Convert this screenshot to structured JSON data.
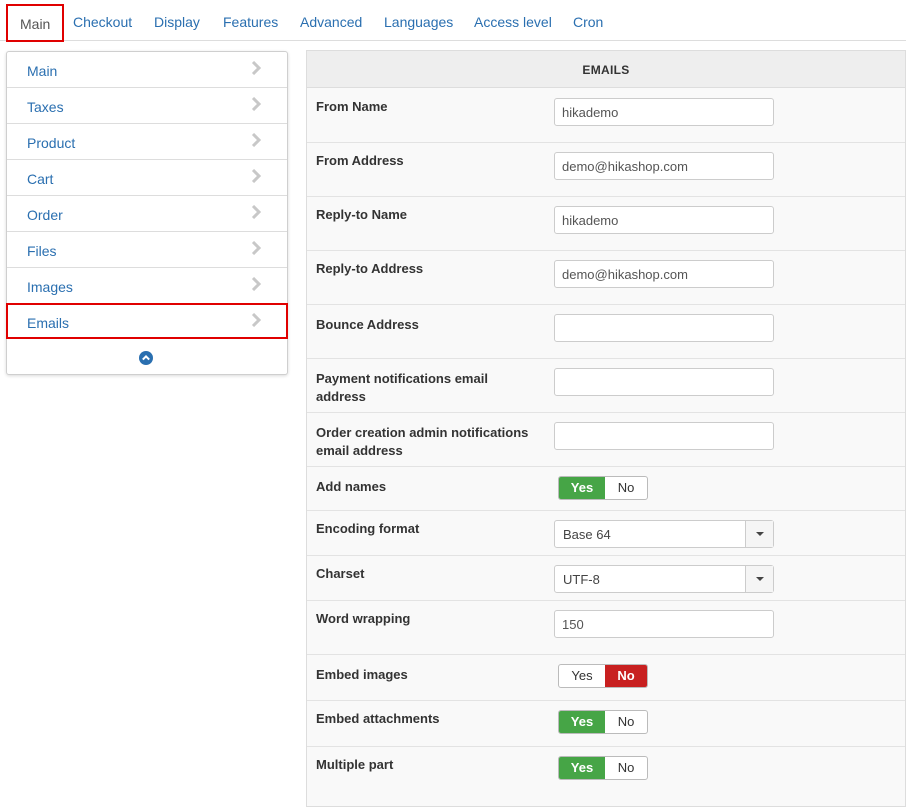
{
  "tabs": [
    {
      "label": "Main",
      "active": true
    },
    {
      "label": "Checkout"
    },
    {
      "label": "Display"
    },
    {
      "label": "Features"
    },
    {
      "label": "Advanced"
    },
    {
      "label": "Languages"
    },
    {
      "label": "Access level"
    },
    {
      "label": "Cron"
    }
  ],
  "sidebar": {
    "items": [
      {
        "label": "Main"
      },
      {
        "label": "Taxes"
      },
      {
        "label": "Product"
      },
      {
        "label": "Cart"
      },
      {
        "label": "Order"
      },
      {
        "label": "Files"
      },
      {
        "label": "Images"
      },
      {
        "label": "Emails",
        "active": true
      }
    ],
    "collapse_icon": "chevron-circle-up-icon"
  },
  "panel": {
    "title": "EMAILS",
    "fields": {
      "from_name": {
        "label": "From Name",
        "value": "hikademo"
      },
      "from_address": {
        "label": "From Address",
        "value": "demo@hikashop.com"
      },
      "reply_to_name": {
        "label": "Reply-to Name",
        "value": "hikademo"
      },
      "reply_to_address": {
        "label": "Reply-to Address",
        "value": "demo@hikashop.com"
      },
      "bounce_address": {
        "label": "Bounce Address",
        "value": ""
      },
      "payment_notifications": {
        "label": "Payment notifications email address",
        "value": ""
      },
      "order_creation_notifications": {
        "label": "Order creation admin notifications email address",
        "value": ""
      },
      "add_names": {
        "label": "Add names",
        "yes": "Yes",
        "no": "No",
        "selected": "Yes"
      },
      "encoding_format": {
        "label": "Encoding format",
        "value": "Base 64"
      },
      "charset": {
        "label": "Charset",
        "value": "UTF-8"
      },
      "word_wrapping": {
        "label": "Word wrapping",
        "value": "150"
      },
      "embed_images": {
        "label": "Embed images",
        "yes": "Yes",
        "no": "No",
        "selected": "No"
      },
      "embed_attachments": {
        "label": "Embed attachments",
        "yes": "Yes",
        "no": "No",
        "selected": "Yes"
      },
      "multiple_part": {
        "label": "Multiple part",
        "yes": "Yes",
        "no": "No",
        "selected": "Yes"
      }
    }
  },
  "colors": {
    "link": "#2a6fb0",
    "highlight": "#e00000",
    "yes_active": "#46a546",
    "no_active": "#c82020"
  }
}
